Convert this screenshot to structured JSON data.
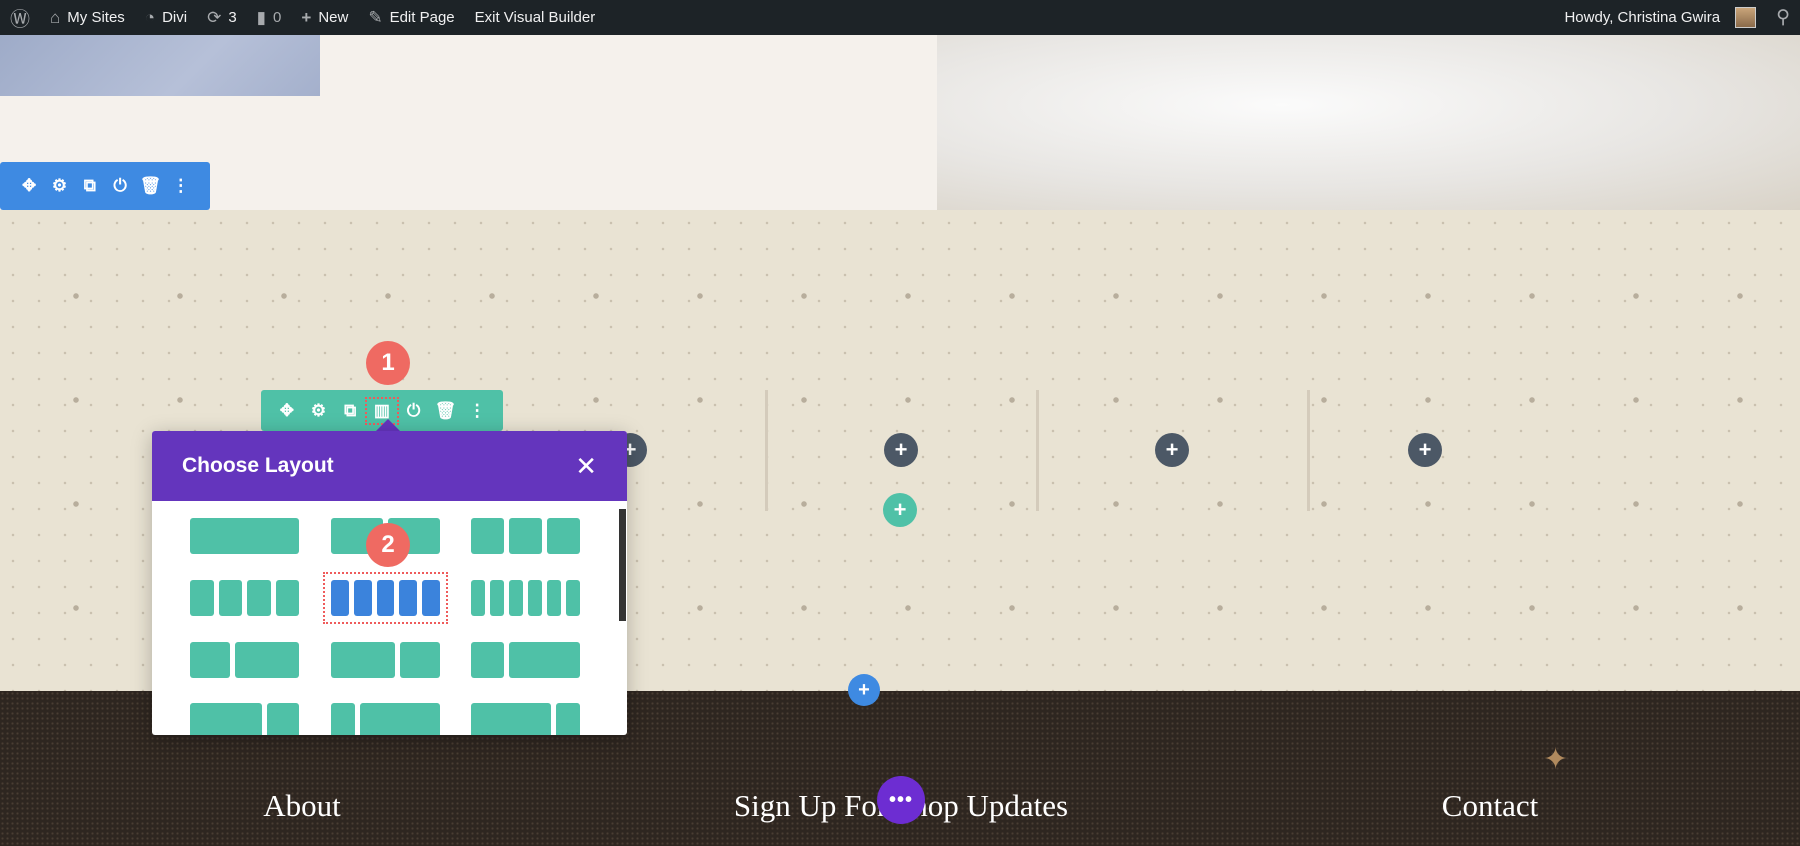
{
  "adminbar": {
    "items": [
      {
        "icon": "wordpress-icon",
        "label": ""
      },
      {
        "icon": "my-sites-icon",
        "label": "My Sites"
      },
      {
        "icon": "divi-dashboard-icon",
        "label": "Divi"
      },
      {
        "icon": "updates-icon",
        "label": "3"
      },
      {
        "icon": "comment-icon",
        "label": "0"
      },
      {
        "icon": "plus-icon",
        "label": "New"
      },
      {
        "icon": "pencil-icon",
        "label": "Edit Page"
      },
      {
        "icon": "",
        "label": "Exit Visual Builder"
      }
    ],
    "howdy": "Howdy, Christina Gwira",
    "search_icon": "search-icon"
  },
  "row_toolbar": {
    "icons": [
      "move-icon",
      "gear-icon",
      "duplicate-icon",
      "power-icon",
      "trash-icon",
      "more-icon"
    ]
  },
  "column_toolbar": {
    "icons": [
      "move-icon",
      "gear-icon",
      "duplicate-icon",
      "columns-icon",
      "power-icon",
      "trash-icon",
      "more-icon"
    ],
    "highlighted": "columns-icon"
  },
  "badges": {
    "step1": "1",
    "step2": "2"
  },
  "popup": {
    "title": "Choose Layout",
    "close_icon": "close-icon",
    "selected_layout": "5 columns"
  },
  "footer": {
    "headings": [
      "About",
      "Sign Up For Shop Updates",
      "Contact"
    ]
  },
  "colors": {
    "divi_purple": "#6435bd",
    "divi_green": "#4fc1a7",
    "divi_blue": "#3e8ae2",
    "badge_red": "#ef6a62"
  }
}
